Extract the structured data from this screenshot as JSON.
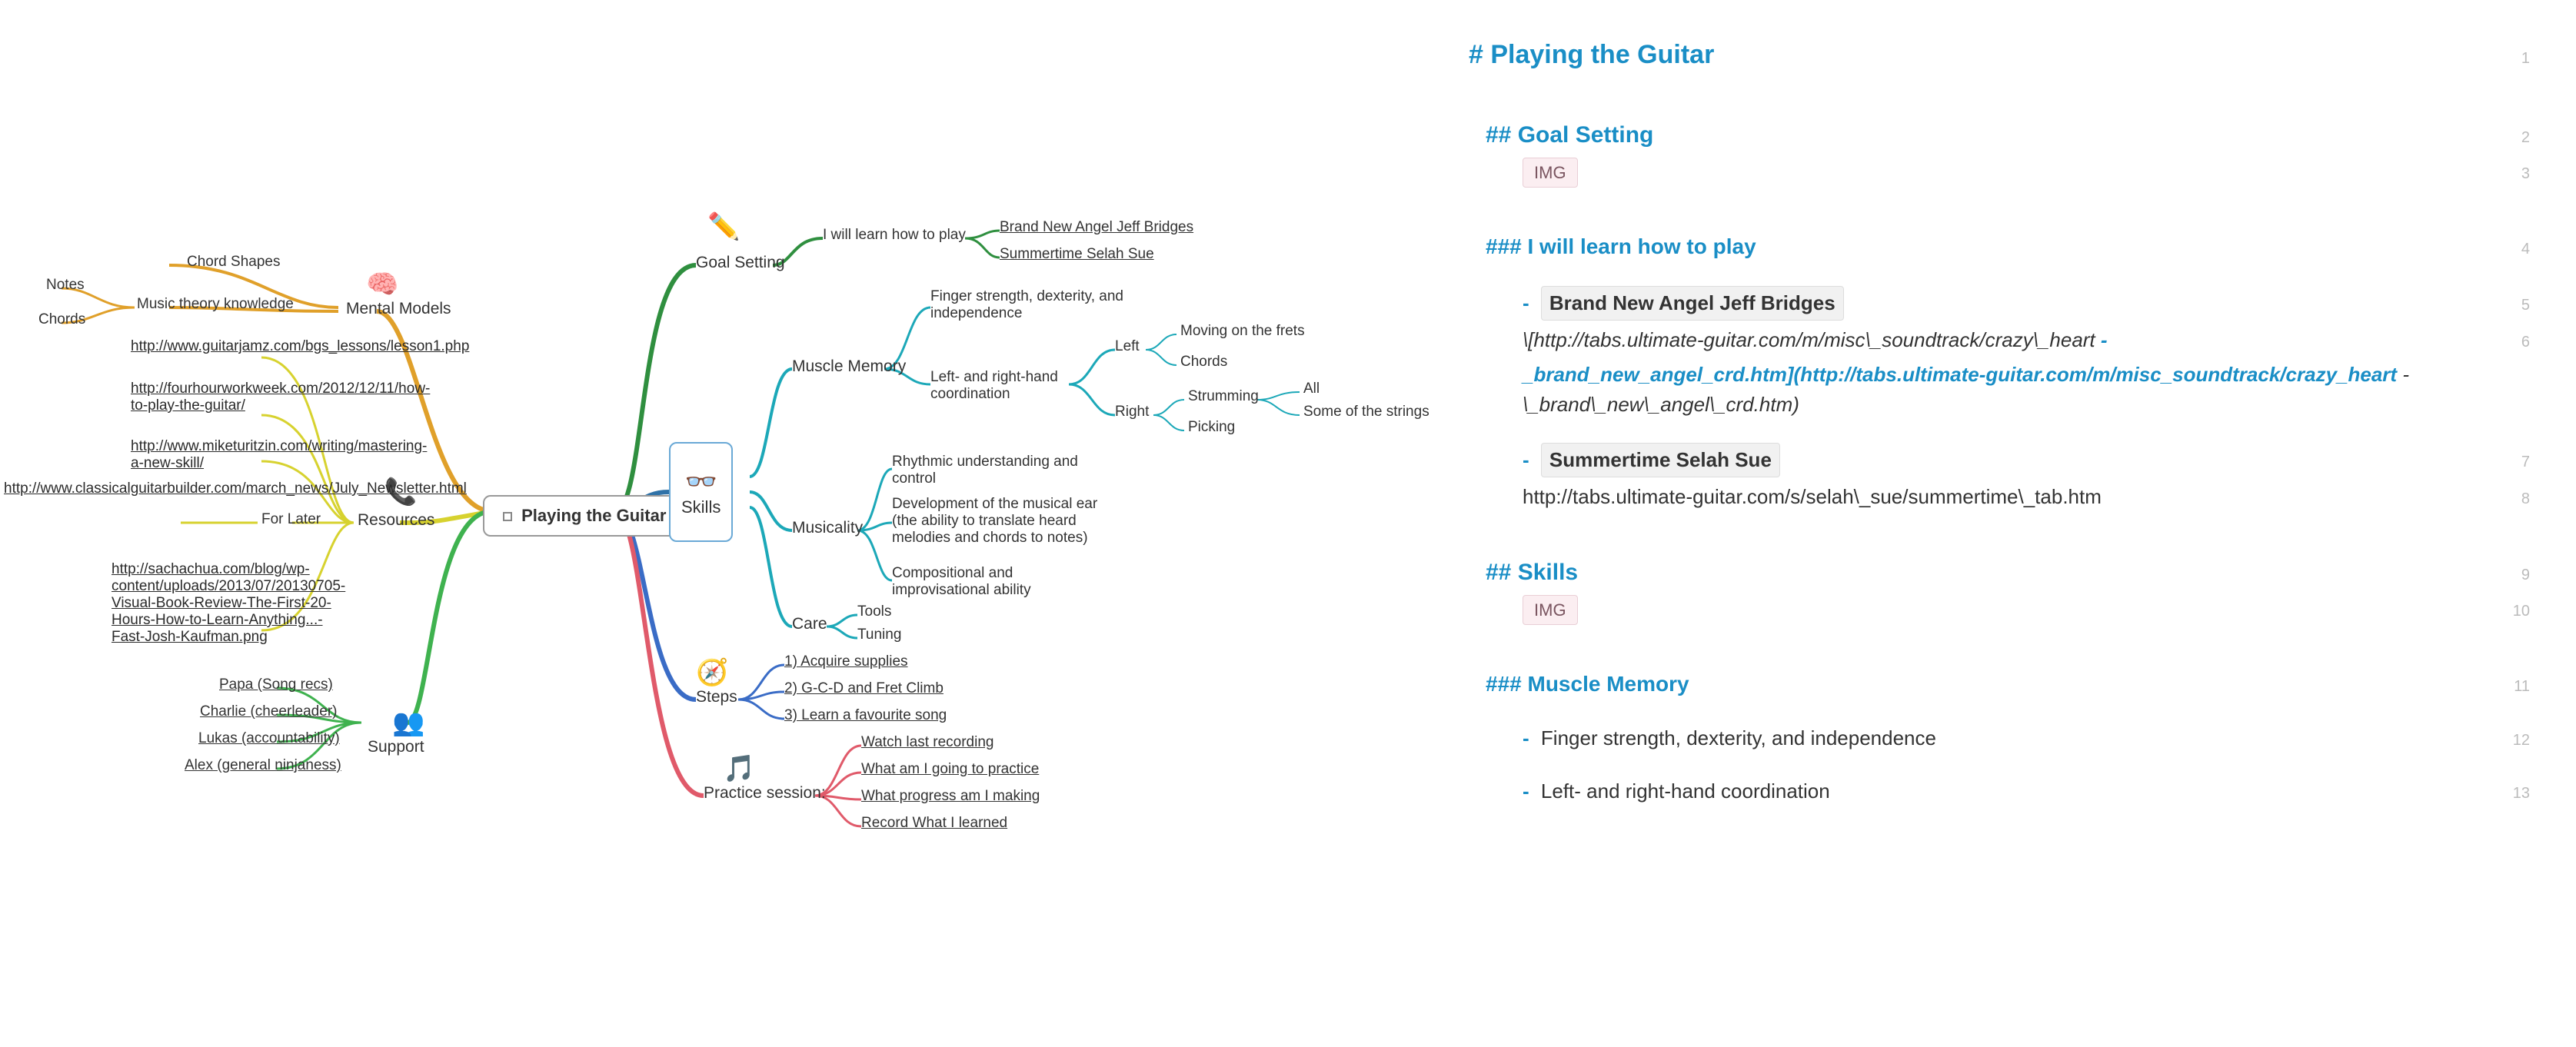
{
  "mindmap": {
    "center": "Playing the Guitar",
    "skills_box": "Skills",
    "branches": {
      "mental_models": {
        "label": "Mental Models",
        "icon": "brain-icon",
        "children": {
          "chord_shapes": "Chord Shapes",
          "music_theory": "Music theory knowledge",
          "notes": "Notes",
          "chords": "Chords"
        }
      },
      "resources": {
        "label": "Resources",
        "icon": "phone-icon",
        "for_later": "For Later",
        "links": {
          "guitarjamz": "http://www.guitarjamz.com/bgs_lessons/lesson1.php",
          "fourhour": "http://fourhourworkweek.com/2012/12/11/how-to-play-the-guitar/",
          "miketuritzin": "http://www.miketuritzin.com/writing/mastering-a-new-skill/",
          "classicalguitar": "http://www.classicalguitarbuilder.com/march_news/July_Newsletter.html",
          "sachachua": "http://sachachua.com/blog/wp-content/uploads/2013/07/20130705-Visual-Book-Review-The-First-20-Hours-How-to-Learn-Anything...-Fast-Josh-Kaufman.png"
        }
      },
      "support": {
        "label": "Support",
        "icon": "people-icon",
        "people": {
          "papa": "Papa (Song recs)",
          "charlie": "Charlie (cheerleader)",
          "lukas": "Lukas (accountability)",
          "alex": "Alex (general ninjaness)"
        }
      },
      "goal_setting": {
        "label": "Goal Setting",
        "icon": "pencil-icon",
        "learn": "I will learn how to play",
        "songs": {
          "brand_new_angel": "Brand New Angel Jeff Bridges",
          "summertime": "Summertime Selah Sue"
        }
      },
      "skills": {
        "muscle_memory": {
          "label": "Muscle Memory",
          "finger": "Finger strength, dexterity, and independence",
          "coord": "Left- and right-hand coordination",
          "left": "Left",
          "right": "Right",
          "moving": "Moving on the frets",
          "chords": "Chords",
          "strumming": "Strumming",
          "picking": "Picking",
          "all": "All",
          "some": "Some of the strings"
        },
        "musicality": {
          "label": "Musicality",
          "rhythmic": "Rhythmic understanding and control",
          "ear": "Development of the musical ear (the ability to translate heard melodies and chords to notes)",
          "comp": "Compositional and improvisational ability"
        },
        "care": {
          "label": "Care",
          "tools": "Tools",
          "tuning": "Tuning"
        }
      },
      "steps": {
        "label": "Steps",
        "icon": "compass-icon",
        "s1": "1) Acquire supplies",
        "s2": "2) G-C-D and Fret Climb",
        "s3": "3) Learn a favourite song"
      },
      "practice": {
        "label": "Practice session:",
        "icon": "music-icon",
        "p1": "Watch last recording",
        "p2": "What am I going to practice",
        "p3": "What progress am I making",
        "p4": "Record What I learned"
      }
    }
  },
  "editor": {
    "h1": "# Playing the Guitar",
    "goal_h2": "## Goal Setting",
    "img_label": "IMG",
    "learn_h3": "### I will learn how to play",
    "bna_code": "Brand New Angel Jeff Bridges",
    "bna_line_pre": "\\[http://tabs.ultimate-guitar.com/m/misc\\_soundtrack/crazy\\_heart",
    "bna_line_dash": "-",
    "bna_link": "_brand_new_angel_crd.htm](http://tabs.ultimate-guitar.com/m/misc_soundtrack/crazy_heart",
    "bna_tail": "-\\_brand\\_new\\_angel\\_crd.htm)",
    "sss_code": "Summertime Selah Sue",
    "sss_url": "http://tabs.ultimate-guitar.com/s/selah\\_sue/summertime\\_tab.htm",
    "skills_h2": "## Skills",
    "mm_h3": "### Muscle Memory",
    "mm1": "Finger strength, dexterity, and independence",
    "mm2": "Left- and right-hand coordination",
    "line_numbers": [
      "1",
      "2",
      "3",
      "4",
      "5",
      "6",
      "7",
      "8",
      "9",
      "10",
      "11",
      "12",
      "13"
    ]
  }
}
